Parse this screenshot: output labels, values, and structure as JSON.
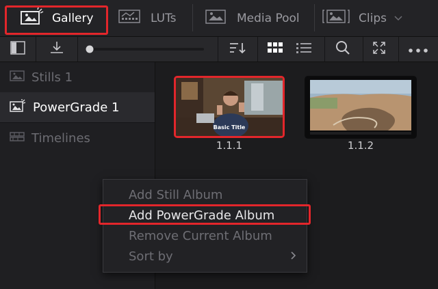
{
  "tabs": [
    {
      "label": "Gallery",
      "icon": "gallery-icon",
      "active": true
    },
    {
      "label": "LUTs",
      "icon": "luts-icon",
      "active": false
    },
    {
      "label": "Media Pool",
      "icon": "media-pool-icon",
      "active": false
    },
    {
      "label": "Clips",
      "icon": "clips-icon",
      "active": false
    }
  ],
  "toolbar": {
    "icons": [
      "sidebar-toggle-icon",
      "import-icon",
      "zoom-slider",
      "sort-icon",
      "grid-view-icon",
      "list-view-icon",
      "search-icon",
      "fit-icon",
      "more-options-icon"
    ],
    "zoom_level": 0
  },
  "sidebar": {
    "items": [
      {
        "label": "Stills 1",
        "icon": "stills-icon",
        "active": false
      },
      {
        "label": "PowerGrade 1",
        "icon": "powergrade-icon",
        "active": true
      },
      {
        "label": "Timelines",
        "icon": "timelines-icon",
        "active": false
      }
    ]
  },
  "gallery": {
    "thumbnails": [
      {
        "caption": "1.1.1",
        "overlay_text": "Basic Title",
        "selected": true
      },
      {
        "caption": "1.1.2",
        "overlay_text": "",
        "selected": false
      }
    ]
  },
  "context_menu": {
    "items": [
      {
        "label": "Add Still Album",
        "enabled": false
      },
      {
        "label": "Add PowerGrade Album",
        "enabled": true,
        "highlighted": true
      },
      {
        "label": "Remove Current Album",
        "enabled": false
      },
      {
        "label": "Sort by",
        "enabled": false,
        "submenu": true
      }
    ]
  },
  "colors": {
    "highlight_red": "#e3262b",
    "background": "#1c1c1e",
    "active_text": "#ffffff"
  }
}
